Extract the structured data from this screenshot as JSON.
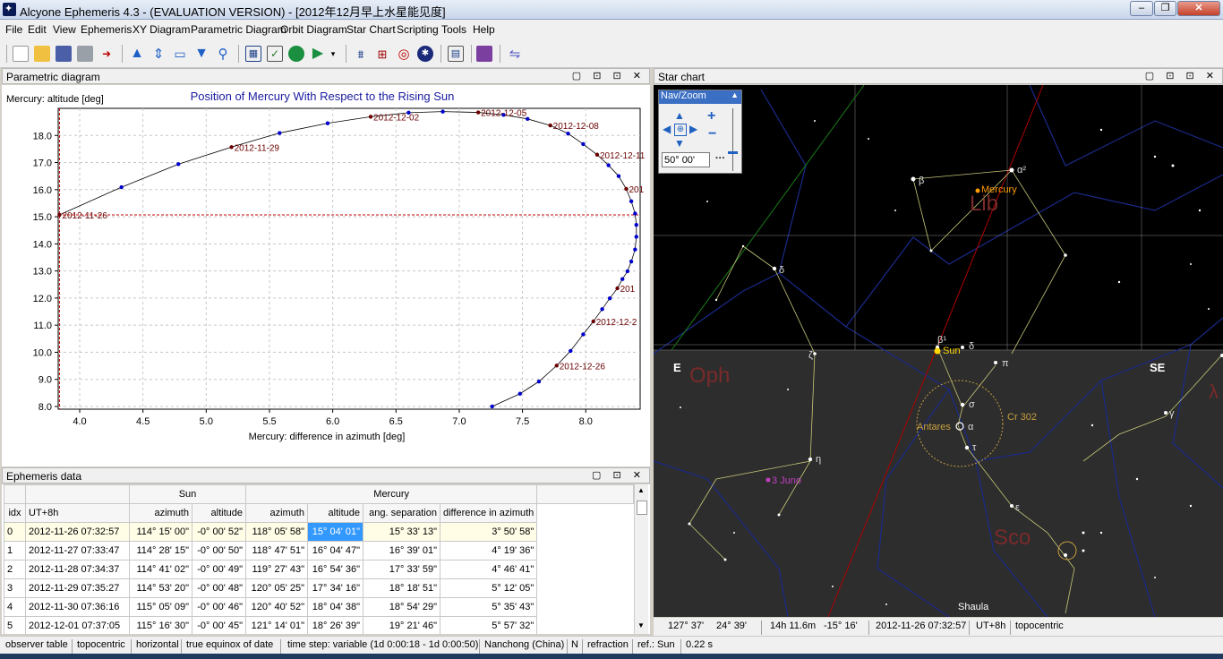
{
  "window": {
    "title": "Alcyone Ephemeris 4.3 - (EVALUATION VERSION) - [2012年12月早上水星能见度]"
  },
  "menu": [
    "File",
    "Edit",
    "View",
    "Ephemeris",
    "XY Diagram",
    "Parametric Diagram",
    "Orbit Diagram",
    "Star Chart",
    "Scripting",
    "Tools",
    "Help"
  ],
  "panels": {
    "parametric": "Parametric diagram",
    "star": "Star chart",
    "ephem": "Ephemeris data"
  },
  "chart_data": {
    "type": "line",
    "title": "Position of Mercury With Respect to the Rising Sun",
    "xlabel": "Mercury: difference in azimuth [deg]",
    "ylabel": "Mercury: altitude [deg]",
    "xlim": [
      3.83,
      8.43
    ],
    "ylim": [
      7.9,
      19.0
    ],
    "xticks": [
      "4.0",
      "4.5",
      "5.0",
      "5.5",
      "6.0",
      "6.5",
      "7.0",
      "7.5",
      "8.0"
    ],
    "yticks": [
      "8.0",
      "9.0",
      "10.0",
      "11.0",
      "12.0",
      "13.0",
      "14.0",
      "15.0",
      "16.0",
      "17.0",
      "18.0"
    ],
    "grid": true,
    "series": [
      {
        "x": [
          3.84,
          4.33,
          4.78,
          5.2,
          5.58,
          5.96,
          6.3,
          6.6,
          6.87,
          7.15,
          7.35,
          7.54,
          7.72,
          7.86,
          7.98,
          8.09,
          8.18,
          8.26,
          8.32,
          8.36,
          8.39,
          8.4,
          8.4,
          8.39,
          8.36,
          8.33,
          8.29,
          8.25,
          8.19,
          8.13,
          8.06,
          7.98,
          7.88,
          7.77,
          7.63,
          7.48,
          7.26
        ],
        "y": [
          15.07,
          16.09,
          16.94,
          17.57,
          18.09,
          18.45,
          18.69,
          18.84,
          18.88,
          18.85,
          18.76,
          18.61,
          18.37,
          18.07,
          17.68,
          17.29,
          16.9,
          16.5,
          16.03,
          15.57,
          15.12,
          14.7,
          14.26,
          13.79,
          13.35,
          12.99,
          12.7,
          12.36,
          11.99,
          11.59,
          11.14,
          10.66,
          10.05,
          9.51,
          8.92,
          8.47,
          8.0
        ]
      }
    ],
    "point_labels": [
      {
        "i": 0,
        "text": "2012-11-26"
      },
      {
        "i": 3,
        "text": "2012-11-29"
      },
      {
        "i": 6,
        "text": "2012-12-02"
      },
      {
        "i": 9,
        "text": "2012-12-05"
      },
      {
        "i": 12,
        "text": "2012-12-08"
      },
      {
        "i": 15,
        "text": "2012-12-11"
      },
      {
        "i": 18,
        "text": "201"
      },
      {
        "i": 27,
        "text": "201"
      },
      {
        "i": 30,
        "text": "2012-12-2"
      },
      {
        "i": 33,
        "text": "2012-12-26"
      }
    ],
    "markers": {
      "h_line_y": 15.07,
      "v_line_x": 3.84
    }
  },
  "ephemeris": {
    "group_headers": {
      "sun": "Sun",
      "mercury": "Mercury"
    },
    "columns": [
      "idx",
      "UT+8h",
      "azimuth",
      "altitude",
      "azimuth",
      "altitude",
      "ang. separation",
      "difference in azimuth"
    ],
    "rows": [
      [
        "0",
        "2012-11-26  07:32:57",
        "114° 15' 00\"",
        "-0° 00' 52\"",
        "118° 05' 58\"",
        "15° 04' 01\"",
        "15° 33' 13\"",
        "3° 50' 58\""
      ],
      [
        "1",
        "2012-11-27  07:33:47",
        "114° 28' 15\"",
        "-0° 00' 50\"",
        "118° 47' 51\"",
        "16° 04' 47\"",
        "16° 39' 01\"",
        "4° 19' 36\""
      ],
      [
        "2",
        "2012-11-28  07:34:37",
        "114° 41' 02\"",
        "-0° 00' 49\"",
        "119° 27' 43\"",
        "16° 54' 36\"",
        "17° 33' 59\"",
        "4° 46' 41\""
      ],
      [
        "3",
        "2012-11-29  07:35:27",
        "114° 53' 20\"",
        "-0° 00' 48\"",
        "120° 05' 25\"",
        "17° 34' 16\"",
        "18° 18' 51\"",
        "5° 12' 05\""
      ],
      [
        "4",
        "2012-11-30  07:36:16",
        "115° 05' 09\"",
        "-0° 00' 46\"",
        "120° 40' 52\"",
        "18° 04' 38\"",
        "18° 54' 29\"",
        "5° 35' 43\""
      ],
      [
        "5",
        "2012-12-01  07:37:05",
        "115° 16' 30\"",
        "-0° 00' 45\"",
        "121° 14' 01\"",
        "18° 26' 39\"",
        "19° 21' 46\"",
        "5° 57' 32\""
      ]
    ]
  },
  "star_chart": {
    "labels": {
      "mercury": "Mercury",
      "lib": "Lib",
      "sun": "Sun",
      "antares": "Antares",
      "cr302": "Cr 302",
      "oph": "Oph",
      "sco": "Sco",
      "juno": "3 Juno",
      "shaula": "Shaula",
      "E": "E",
      "SE": "SE",
      "beta": "β",
      "alpha2": "α²",
      "delta_lib": "δ",
      "delta_sco": "δ",
      "beta1": "β¹",
      "pi": "π",
      "sigma": "σ",
      "alpha": "α",
      "tau": "τ",
      "zeta": "ζ",
      "eta": "η",
      "epsilon": "ε",
      "gamma": "γ",
      "delta_oph": "δ",
      "lambda": "λ"
    },
    "nav_zoom": {
      "title": "Nav/Zoom",
      "value": "50° 00'"
    },
    "status": [
      "127° 37'",
      "24° 39'",
      "14h 11.6m",
      "-15° 16'",
      "2012-11-26  07:32:57",
      "UT+8h",
      "topocentric"
    ]
  },
  "statusbar": [
    "observer table",
    "topocentric",
    "horizontal",
    "true equinox of date",
    "time step: variable (1d 0:00:18 - 1d 0:00:50)",
    "Nanchong (China)",
    "N",
    "refraction",
    "ref.: Sun",
    "0.22 s"
  ],
  "colors": {
    "series": "#000000",
    "point": "#0000cc",
    "label": "#6b0000",
    "grid": "#c8c8c8",
    "sky": "#000000",
    "ground": "#2d2d2d",
    "constellation": "#c8c87a",
    "boundary": "#1a2a8a",
    "ecliptic": "#b00000",
    "sun": "#ffd700",
    "mercury": "#ff9c00",
    "juno": "#c040c0"
  }
}
